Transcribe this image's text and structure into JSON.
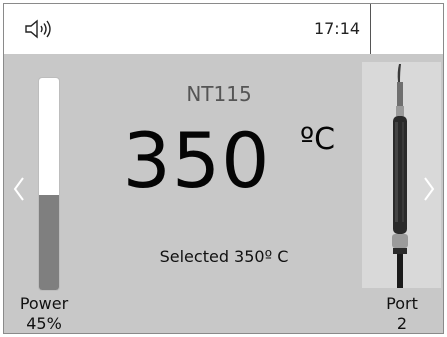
{
  "status_bar": {
    "sound_icon": "speaker-sound-icon",
    "time": "17:14"
  },
  "power": {
    "label": "Power",
    "value_text": "45%",
    "level": 0.45
  },
  "station": {
    "model": "NT115",
    "temperature": "350",
    "unit": "ºC",
    "selected_text": "Selected 350º C"
  },
  "port": {
    "label": "Port",
    "value": "2",
    "tool_icon": "soldering-iron-icon"
  },
  "nav": {
    "left_icon": "chevron-left-icon",
    "right_icon": "chevron-right-icon"
  },
  "colors": {
    "main_bg": "#c8c8c8",
    "bar_fill": "#7f7f7f",
    "tool_panel": "#d9d9d9"
  }
}
